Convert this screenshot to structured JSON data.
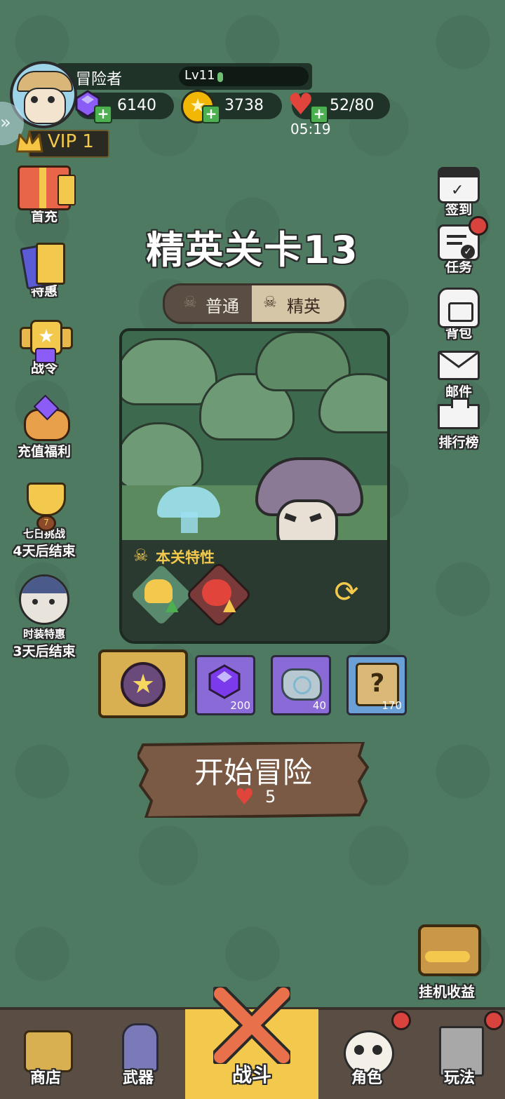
{
  "player": {
    "name": "冒险者",
    "level": "Lv11",
    "vip": "VIP 1"
  },
  "currency": {
    "gems": "6140",
    "coins": "3738",
    "stamina": "52/80",
    "stamina_timer": "05:19"
  },
  "left_menu": [
    {
      "label": "首充",
      "icon": "gift-box-icon"
    },
    {
      "label": "特惠",
      "icon": "cards-icon"
    },
    {
      "label": "战令",
      "icon": "battle-pass-icon"
    },
    {
      "label": "充值福利",
      "icon": "piggy-bank-icon"
    },
    {
      "label": "七日挑战",
      "sub": "4天后结束",
      "icon": "trophy-icon"
    },
    {
      "label": "时装特惠",
      "sub": "3天后结束",
      "icon": "samurai-avatar-icon"
    }
  ],
  "right_menu": [
    {
      "label": "签到",
      "icon": "calendar-icon"
    },
    {
      "label": "任务",
      "icon": "clipboard-icon"
    },
    {
      "label": "背包",
      "icon": "backpack-icon"
    },
    {
      "label": "邮件",
      "icon": "mail-icon"
    },
    {
      "label": "排行榜",
      "icon": "podium-icon"
    }
  ],
  "stage": {
    "title": "精英关卡13",
    "tabs": [
      "普通",
      "精英"
    ],
    "active_tab": "精英",
    "traits_label": "本关特性"
  },
  "rewards": [
    {
      "item": "gem",
      "count": "200"
    },
    {
      "item": "stone",
      "count": "40"
    },
    {
      "item": "scroll",
      "count": "170"
    }
  ],
  "start_button": {
    "label": "开始冒险",
    "cost": "5"
  },
  "idle_rewards": "挂机收益",
  "bottom_nav": [
    {
      "label": "商店"
    },
    {
      "label": "武器"
    },
    {
      "label": "战斗"
    },
    {
      "label": "角色"
    },
    {
      "label": "玩法"
    }
  ],
  "colors": {
    "background": "#4e7a62",
    "nav_active": "#f2c94c",
    "nav_bg": "#5a4e44"
  }
}
